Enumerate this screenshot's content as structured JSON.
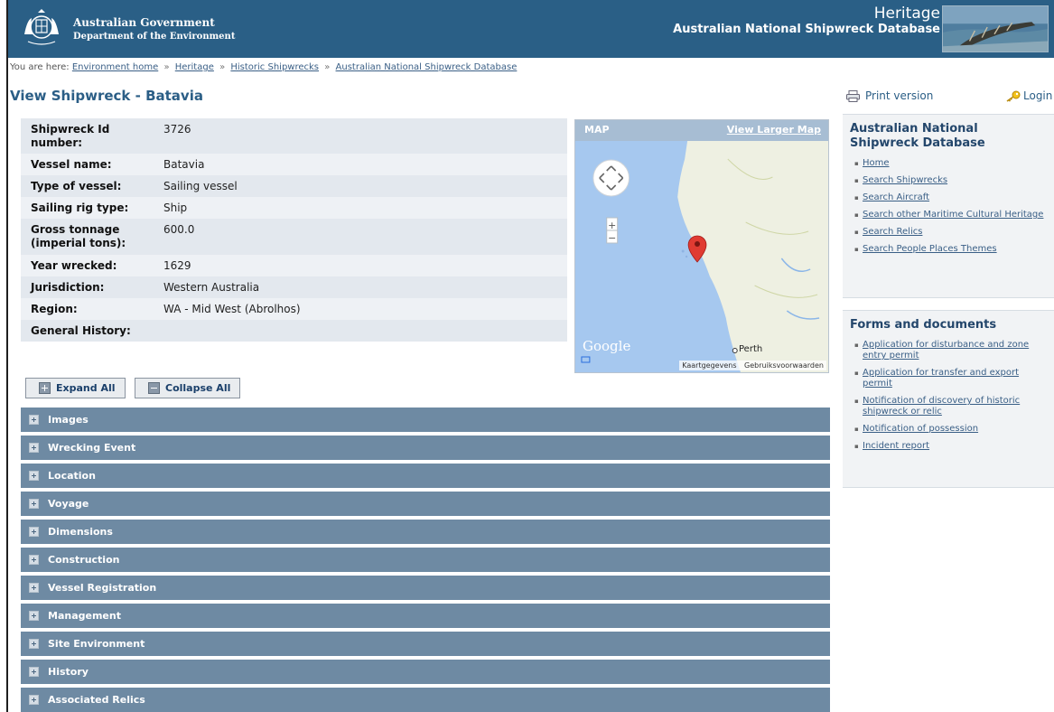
{
  "header": {
    "gov_line1": "Australian Government",
    "gov_line2": "Department of the Environment",
    "heritage_title": "Heritage",
    "heritage_subtitle": "Australian National Shipwreck Database"
  },
  "breadcrumb": {
    "prefix": "You are here:",
    "items": [
      "Environment home",
      "Heritage",
      "Historic Shipwrecks",
      "Australian National Shipwreck Database"
    ],
    "separator": "»"
  },
  "page_title": "View Shipwreck - Batavia",
  "details": [
    {
      "label": "Shipwreck Id number:",
      "value": "3726"
    },
    {
      "label": "Vessel name:",
      "value": "Batavia"
    },
    {
      "label": "Type of vessel:",
      "value": "Sailing vessel"
    },
    {
      "label": "Sailing rig type:",
      "value": "Ship"
    },
    {
      "label": "Gross tonnage (imperial tons):",
      "value": "600.0"
    },
    {
      "label": "Year wrecked:",
      "value": "1629"
    },
    {
      "label": "Jurisdiction:",
      "value": "Western Australia"
    },
    {
      "label": "Region:",
      "value": "WA - Mid West (Abrolhos)"
    },
    {
      "label": "General History:",
      "value": ""
    }
  ],
  "map": {
    "label": "MAP",
    "larger_link": "View Larger Map",
    "google": "Google",
    "city": "Perth",
    "footer_data": "Kaartgegevens",
    "footer_terms": "Gebruiksvoorwaarden",
    "zoom_in": "+",
    "zoom_out": "−",
    "water_color": "#a6c8ef",
    "land_color": "#eef0e2"
  },
  "buttons": {
    "expand_all": "Expand All",
    "collapse_all": "Collapse All"
  },
  "sections": [
    "Images",
    "Wrecking Event",
    "Location",
    "Voyage",
    "Dimensions",
    "Construction",
    "Vessel Registration",
    "Management",
    "Site Environment",
    "History",
    "Associated Relics"
  ],
  "utility": {
    "print": "Print version",
    "login": "Login"
  },
  "sidebar_nav": {
    "title": "Australian National Shipwreck Database",
    "items": [
      "Home",
      "Search Shipwrecks",
      "Search Aircraft",
      "Search other Maritime Cultural Heritage",
      "Search Relics",
      "Search People Places Themes"
    ]
  },
  "sidebar_forms": {
    "title": "Forms and documents",
    "items": [
      "Application for disturbance and zone entry permit",
      "Application for transfer and export permit",
      "Notification of discovery of historic shipwreck or relic",
      "Notification of possession",
      "Incident report"
    ]
  }
}
